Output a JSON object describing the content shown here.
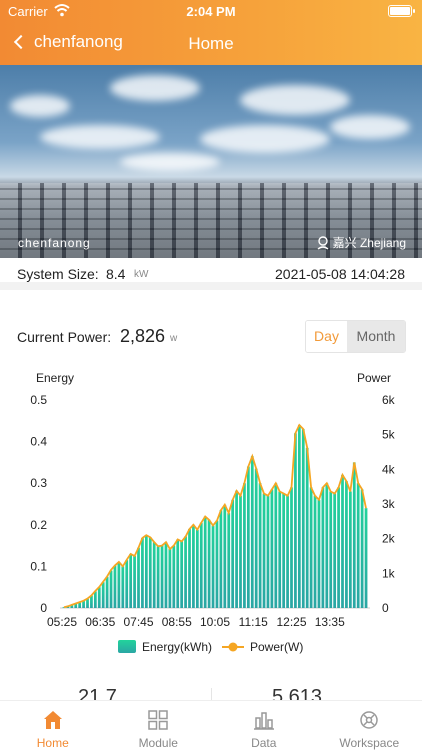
{
  "status_bar": {
    "carrier": "Carrier",
    "time": "2:04 PM"
  },
  "nav": {
    "back_label": "chenfanong",
    "title": "Home"
  },
  "hero": {
    "plant_label": "chenfanong",
    "location": "嘉兴 Zhejiang"
  },
  "system": {
    "label": "System Size:",
    "value": "8.4",
    "unit": "kW",
    "datetime": "2021-05-08 14:04:28"
  },
  "current_power": {
    "label": "Current Power:",
    "value": "2,826",
    "unit": "w"
  },
  "toggle": {
    "day": "Day",
    "month": "Month",
    "selected": "Day"
  },
  "colors": {
    "accent": "#f28a33",
    "bar_top": "#20c997",
    "bar_bottom": "#2ab8a0",
    "line": "#f5a623",
    "inactive": "#888888"
  },
  "chart_data": {
    "type": "bar",
    "left_axis_title": "Energy",
    "right_axis_title": "Power",
    "x_tick_labels": [
      "05:25",
      "06:35",
      "07:45",
      "08:55",
      "10:05",
      "11:15",
      "12:25",
      "13:35"
    ],
    "y_left_ticks": [
      "0",
      "0.1",
      "0.2",
      "0.3",
      "0.4",
      "0.5"
    ],
    "y_right_ticks": [
      "0",
      "1k",
      "2k",
      "3k",
      "4k",
      "5k",
      "6k"
    ],
    "ylim_left": [
      0,
      0.5
    ],
    "ylim_right": [
      0,
      6000
    ],
    "legend": [
      "Energy(kWh)",
      "Power(W)"
    ],
    "legend_position": "bottom",
    "series": [
      {
        "name": "Energy(kWh)",
        "values": [
          0.002,
          0.004,
          0.007,
          0.01,
          0.013,
          0.017,
          0.022,
          0.03,
          0.04,
          0.05,
          0.062,
          0.075,
          0.09,
          0.102,
          0.11,
          0.1,
          0.115,
          0.13,
          0.125,
          0.145,
          0.168,
          0.175,
          0.17,
          0.158,
          0.148,
          0.15,
          0.158,
          0.142,
          0.15,
          0.165,
          0.16,
          0.172,
          0.19,
          0.2,
          0.188,
          0.205,
          0.22,
          0.212,
          0.198,
          0.21,
          0.235,
          0.248,
          0.228,
          0.26,
          0.282,
          0.27,
          0.3,
          0.34,
          0.365,
          0.335,
          0.3,
          0.275,
          0.27,
          0.285,
          0.3,
          0.28,
          0.275,
          0.27,
          0.29,
          0.42,
          0.44,
          0.43,
          0.385,
          0.29,
          0.27,
          0.26,
          0.29,
          0.3,
          0.28,
          0.275,
          0.29,
          0.32,
          0.305,
          0.28,
          0.35,
          0.3,
          0.285,
          0.24
        ]
      },
      {
        "name": "Power(W)",
        "values": [
          20,
          50,
          90,
          130,
          170,
          210,
          270,
          360,
          490,
          610,
          760,
          910,
          1100,
          1230,
          1330,
          1200,
          1390,
          1560,
          1500,
          1740,
          2020,
          2100,
          2040,
          1900,
          1780,
          1800,
          1900,
          1700,
          1800,
          1980,
          1920,
          2060,
          2280,
          2400,
          2260,
          2460,
          2640,
          2540,
          2380,
          2520,
          2820,
          2980,
          2740,
          3120,
          3380,
          3240,
          3600,
          4080,
          4380,
          4020,
          3600,
          3300,
          3240,
          3420,
          3600,
          3360,
          3300,
          3240,
          3480,
          5040,
          5280,
          5160,
          4620,
          3480,
          3240,
          3120,
          3480,
          3600,
          3360,
          3300,
          3480,
          3840,
          3660,
          3360,
          4200,
          3600,
          3420,
          2880
        ]
      }
    ]
  },
  "stats": {
    "value1": "21.7",
    "value2": "5,613"
  },
  "tabs": [
    {
      "label": "Home",
      "icon": "home-icon",
      "active": true
    },
    {
      "label": "Module",
      "icon": "module-icon",
      "active": false
    },
    {
      "label": "Data",
      "icon": "bar-chart-icon",
      "active": false
    },
    {
      "label": "Workspace",
      "icon": "workspace-icon",
      "active": false
    }
  ]
}
